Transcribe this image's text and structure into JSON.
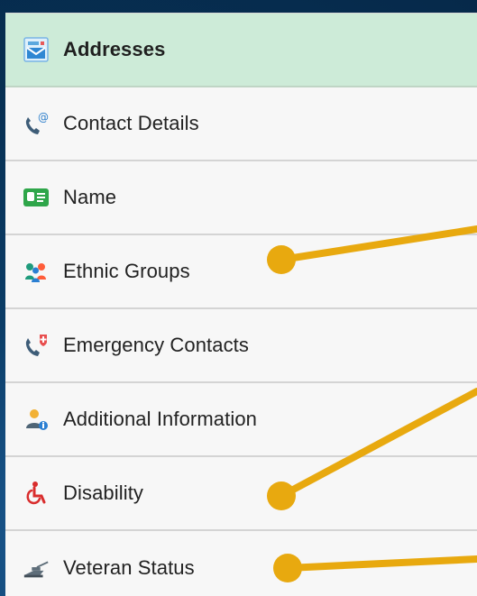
{
  "menu": {
    "items": [
      {
        "label": "Addresses",
        "active": true,
        "icon": "mail-icon"
      },
      {
        "label": "Contact Details",
        "active": false,
        "icon": "phone-email-icon"
      },
      {
        "label": "Name",
        "active": false,
        "icon": "id-card-icon"
      },
      {
        "label": "Ethnic Groups",
        "active": false,
        "icon": "people-group-icon"
      },
      {
        "label": "Emergency Contacts",
        "active": false,
        "icon": "emergency-phone-icon"
      },
      {
        "label": "Additional Information",
        "active": false,
        "icon": "person-info-icon"
      },
      {
        "label": "Disability",
        "active": false,
        "icon": "wheelchair-icon"
      },
      {
        "label": "Veteran Status",
        "active": false,
        "icon": "military-icon"
      }
    ]
  },
  "colors": {
    "active_row": "#cdebd8",
    "callout": "#e8a90f",
    "background": "#08345b"
  }
}
